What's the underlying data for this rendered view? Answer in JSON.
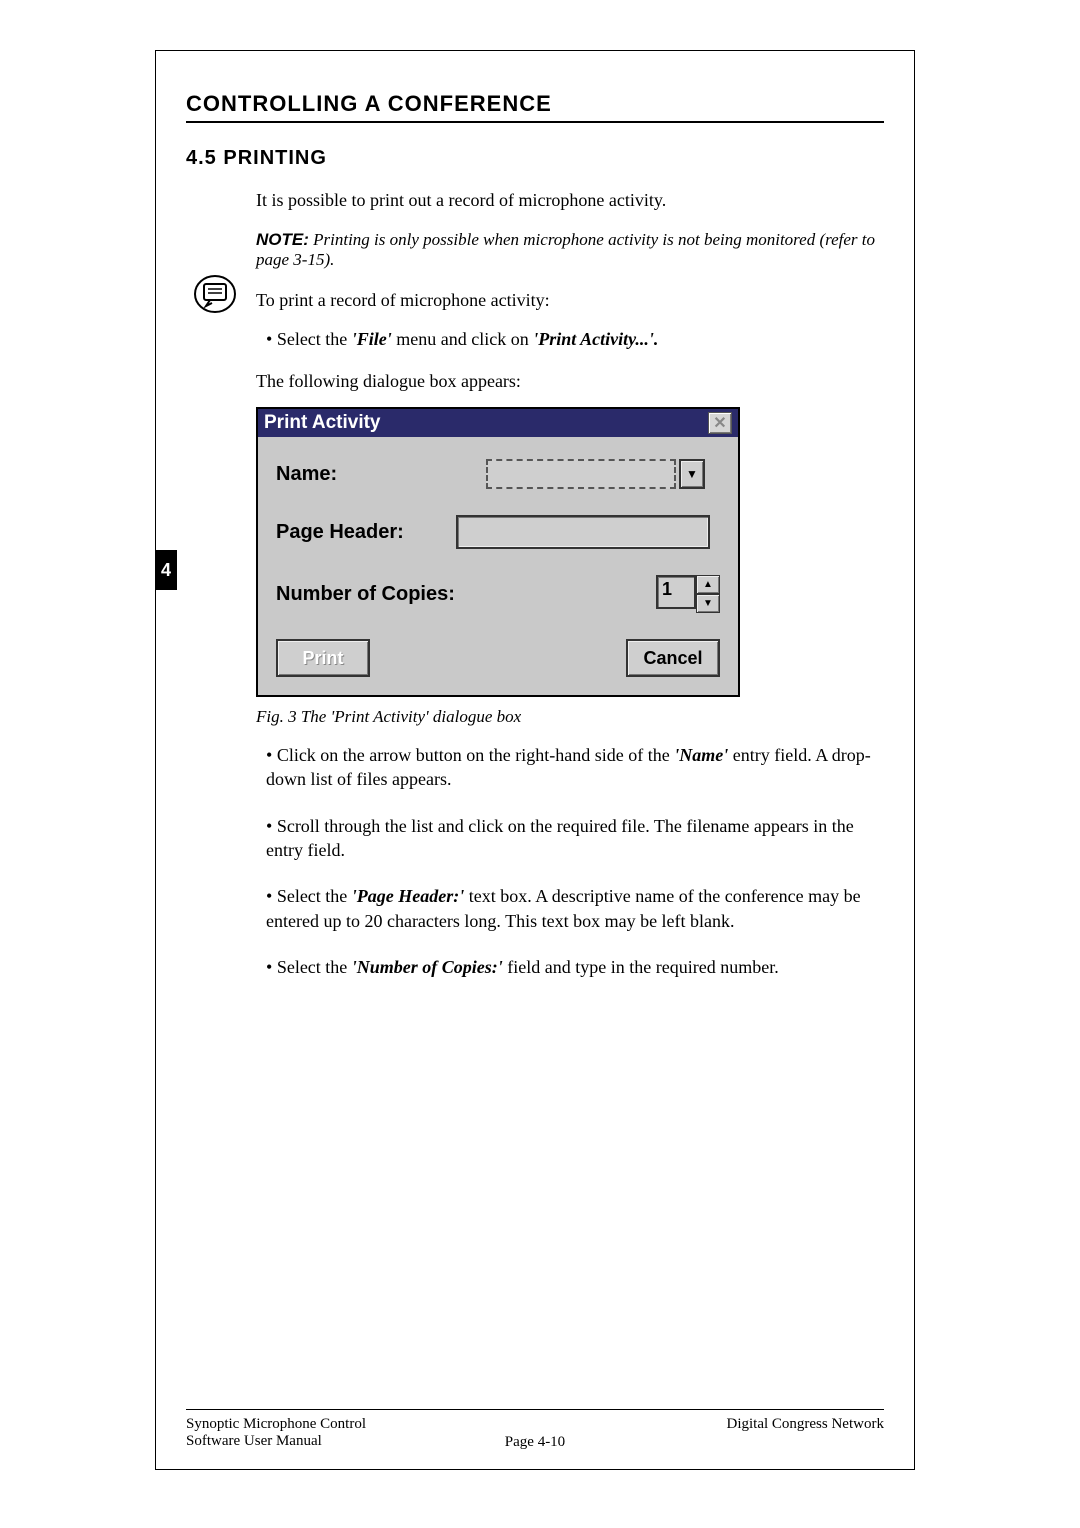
{
  "heading1": "CONTROLLING  A CONFERENCE",
  "heading2": "4.5 PRINTING",
  "intro": "It is possible to print out a record of microphone activity.",
  "note": {
    "label": "NOTE:",
    "text": " Printing is only possible when microphone activity is not being monitored (refer to page 3-15)."
  },
  "para2": "To print a record of microphone activity:",
  "bullet1_pre": "Select the ",
  "bullet1_it": "'File'",
  "bullet1_mid": " menu and click on ",
  "bullet1_it2": "'Print Activity...'.",
  "para3": "The following dialogue box appears:",
  "dialog": {
    "title": "Print Activity",
    "close": "✕",
    "name_label": "Name:",
    "header_label": "Page Header:",
    "copies_label": "Number of Copies:",
    "copies_value": "1",
    "print_btn": "Print",
    "cancel_btn": "Cancel"
  },
  "caption": "Fig. 3 The 'Print Activity' dialogue box",
  "bullet2_pre": "Click on the arrow button on the right-hand side of the ",
  "bullet2_it": "'Name'",
  "bullet2_post": " entry field. A drop-down list of files appears.",
  "bullet3": "Scroll through the list and click on the required file. The filename appears in the entry field.",
  "bullet4_pre": "Select the ",
  "bullet4_it": "'Page Header:'",
  "bullet4_post": " text box. A descriptive name of the conference may be entered up to 20 characters long. This text box may be left blank.",
  "bullet5_pre": "Select the ",
  "bullet5_it": "'Number of Copies:'",
  "bullet5_post": " field and type in the required number.",
  "chapter_tab": "4",
  "footer": {
    "left1": "Synoptic Microphone Control",
    "left2": "Software User Manual",
    "center": "Page 4-10",
    "right": "Digital Congress Network"
  }
}
